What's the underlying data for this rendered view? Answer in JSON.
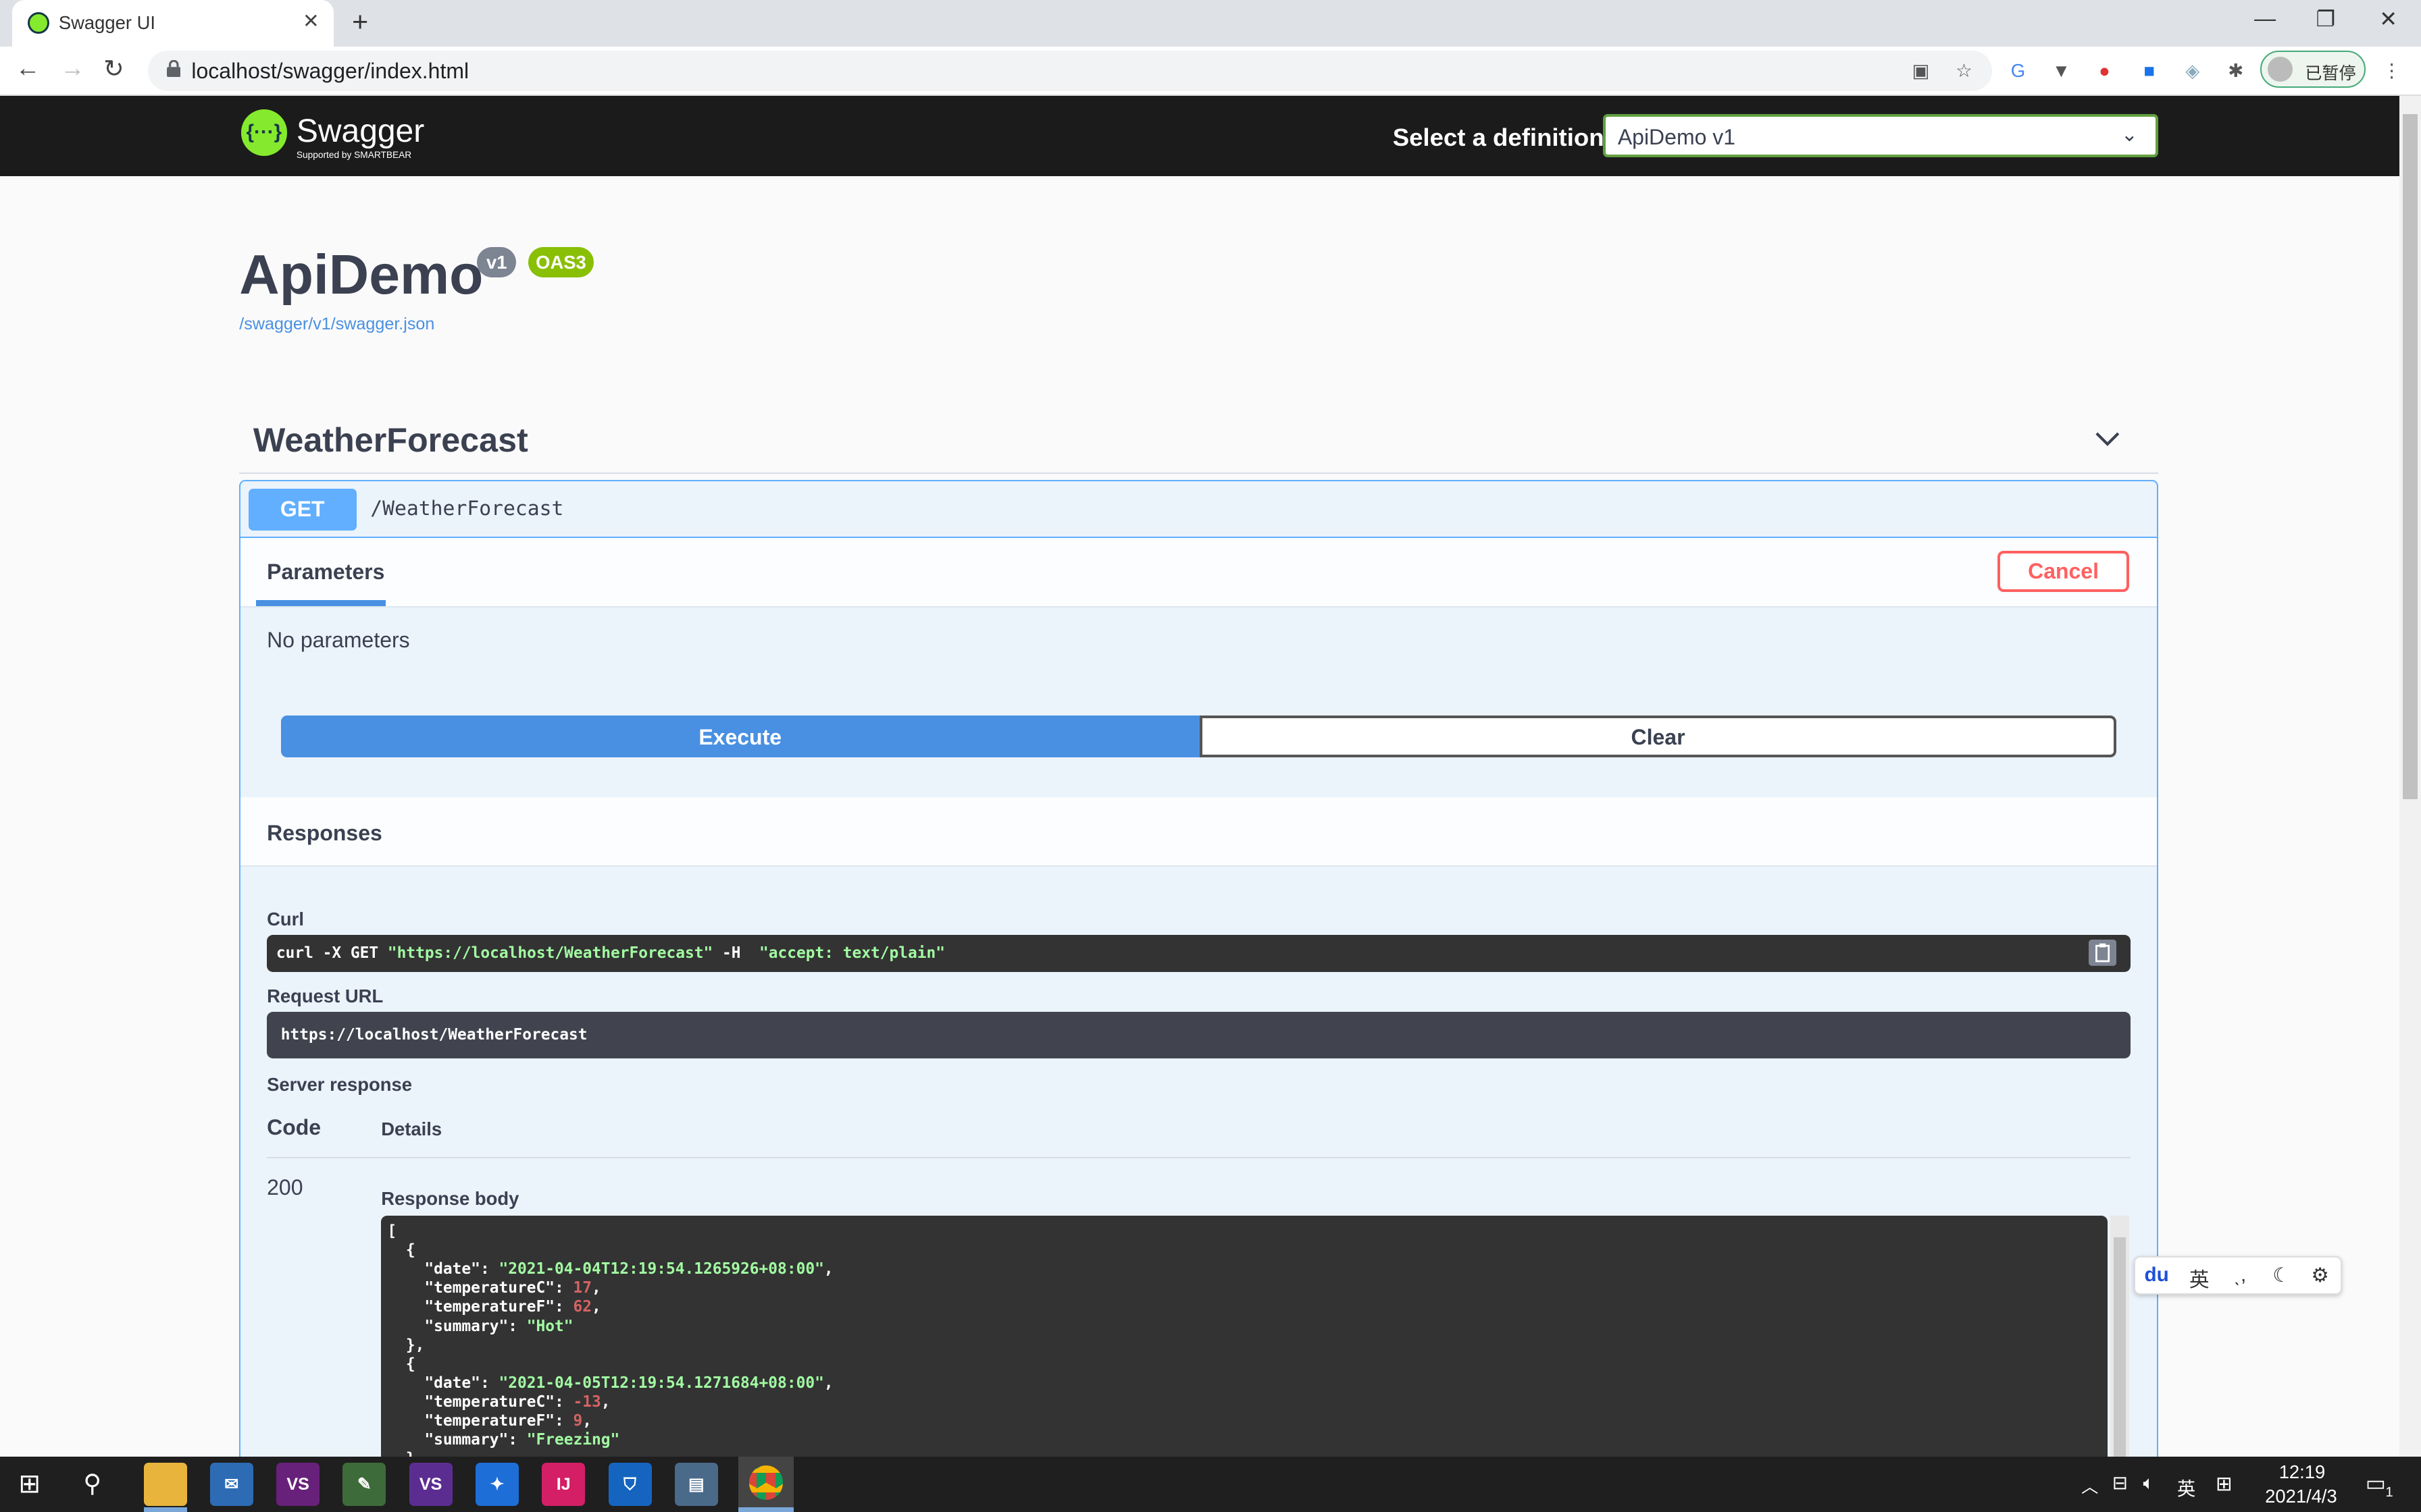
{
  "browser": {
    "tab_title": "Swagger UI",
    "tab_close": "✕",
    "new_tab": "+",
    "url": "localhost/swagger/index.html",
    "profile_label": "已暂停"
  },
  "swagger": {
    "logo_text": "Swagger",
    "logo_sub": "Supported by SMARTBEAR",
    "logo_mark": "{···}",
    "select_label": "Select a definition",
    "definition_value": "ApiDemo v1",
    "api_title": "ApiDemo",
    "version": "v1",
    "oas": "OAS3",
    "spec_link": "/swagger/v1/swagger.json",
    "tag": "WeatherForecast",
    "operation": {
      "method": "GET",
      "path": "/WeatherForecast",
      "params_tab": "Parameters",
      "cancel_label": "Cancel",
      "no_params": "No parameters",
      "execute_label": "Execute",
      "clear_label": "Clear",
      "responses_title": "Responses",
      "curl_label": "Curl",
      "curl_cmd_prefix": "curl -X GET ",
      "curl_url": "\"https://localhost/WeatherForecast\"",
      "curl_mid": " -H  ",
      "curl_header": "\"accept: text/plain\"",
      "request_url_label": "Request URL",
      "request_url": "https://localhost/WeatherForecast",
      "server_response_label": "Server response",
      "code_col": "Code",
      "details_col": "Details",
      "status_code": "200",
      "response_body_label": "Response body"
    }
  },
  "response_body": [
    {
      "date": "2021-04-04T12:19:54.1265926+08:00",
      "temperatureC": 17,
      "temperatureF": 62,
      "summary": "Hot"
    },
    {
      "date": "2021-04-05T12:19:54.1271684+08:00",
      "temperatureC": -13,
      "temperatureF": 9,
      "summary": "Freezing"
    }
  ],
  "ime": {
    "lang": "英"
  },
  "taskbar": {
    "tray_lang": "英",
    "time": "12:19",
    "date": "2021/4/3",
    "notification_count": "1"
  },
  "colors": {
    "get": "#61affe",
    "execute": "#4990e2",
    "cancel": "#ff6060",
    "swagger_green": "#85ea2d",
    "oas_badge": "#89bf04"
  }
}
